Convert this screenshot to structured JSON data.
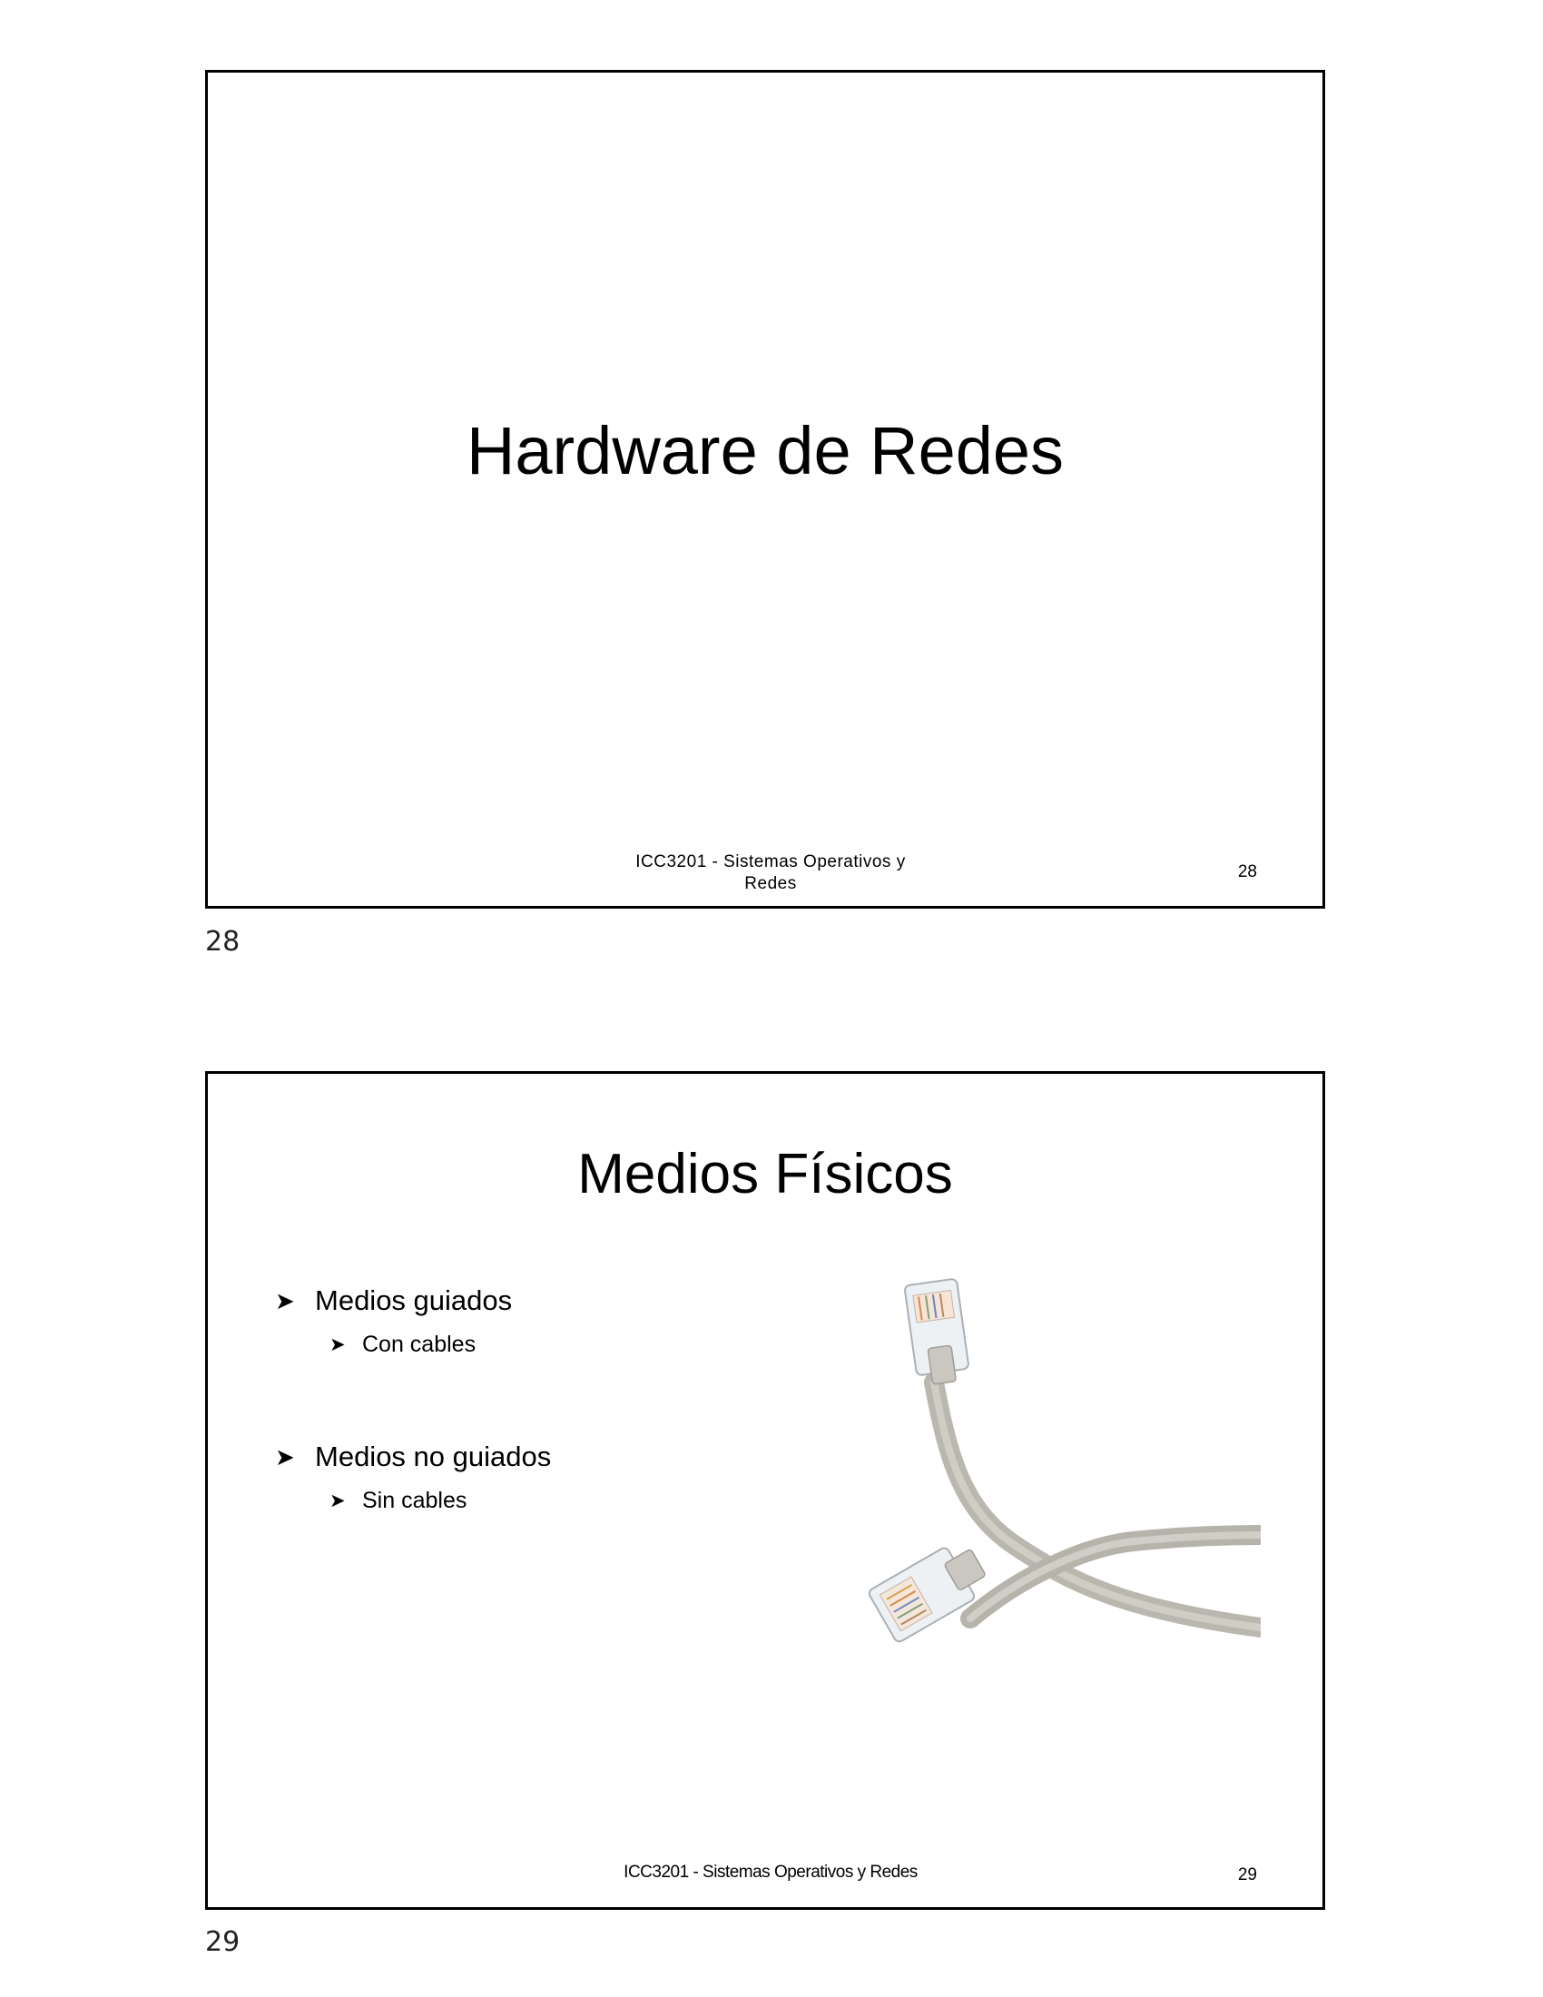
{
  "slides": [
    {
      "title": "Hardware de Redes",
      "footer_line1": "ICC3201 - Sistemas Operativos y",
      "footer_line2": "Redes",
      "slide_number": "28",
      "page_label": "28"
    },
    {
      "title": "Medios Físicos",
      "bullets": [
        {
          "text": "Medios guiados",
          "sub": "Con cables"
        },
        {
          "text": "Medios no guiados",
          "sub": "Sin cables"
        }
      ],
      "footer": "ICC3201 - Sistemas Operativos y Redes",
      "slide_number": "29",
      "page_label": "29",
      "image_icon": "ethernet-cable-icon"
    }
  ]
}
